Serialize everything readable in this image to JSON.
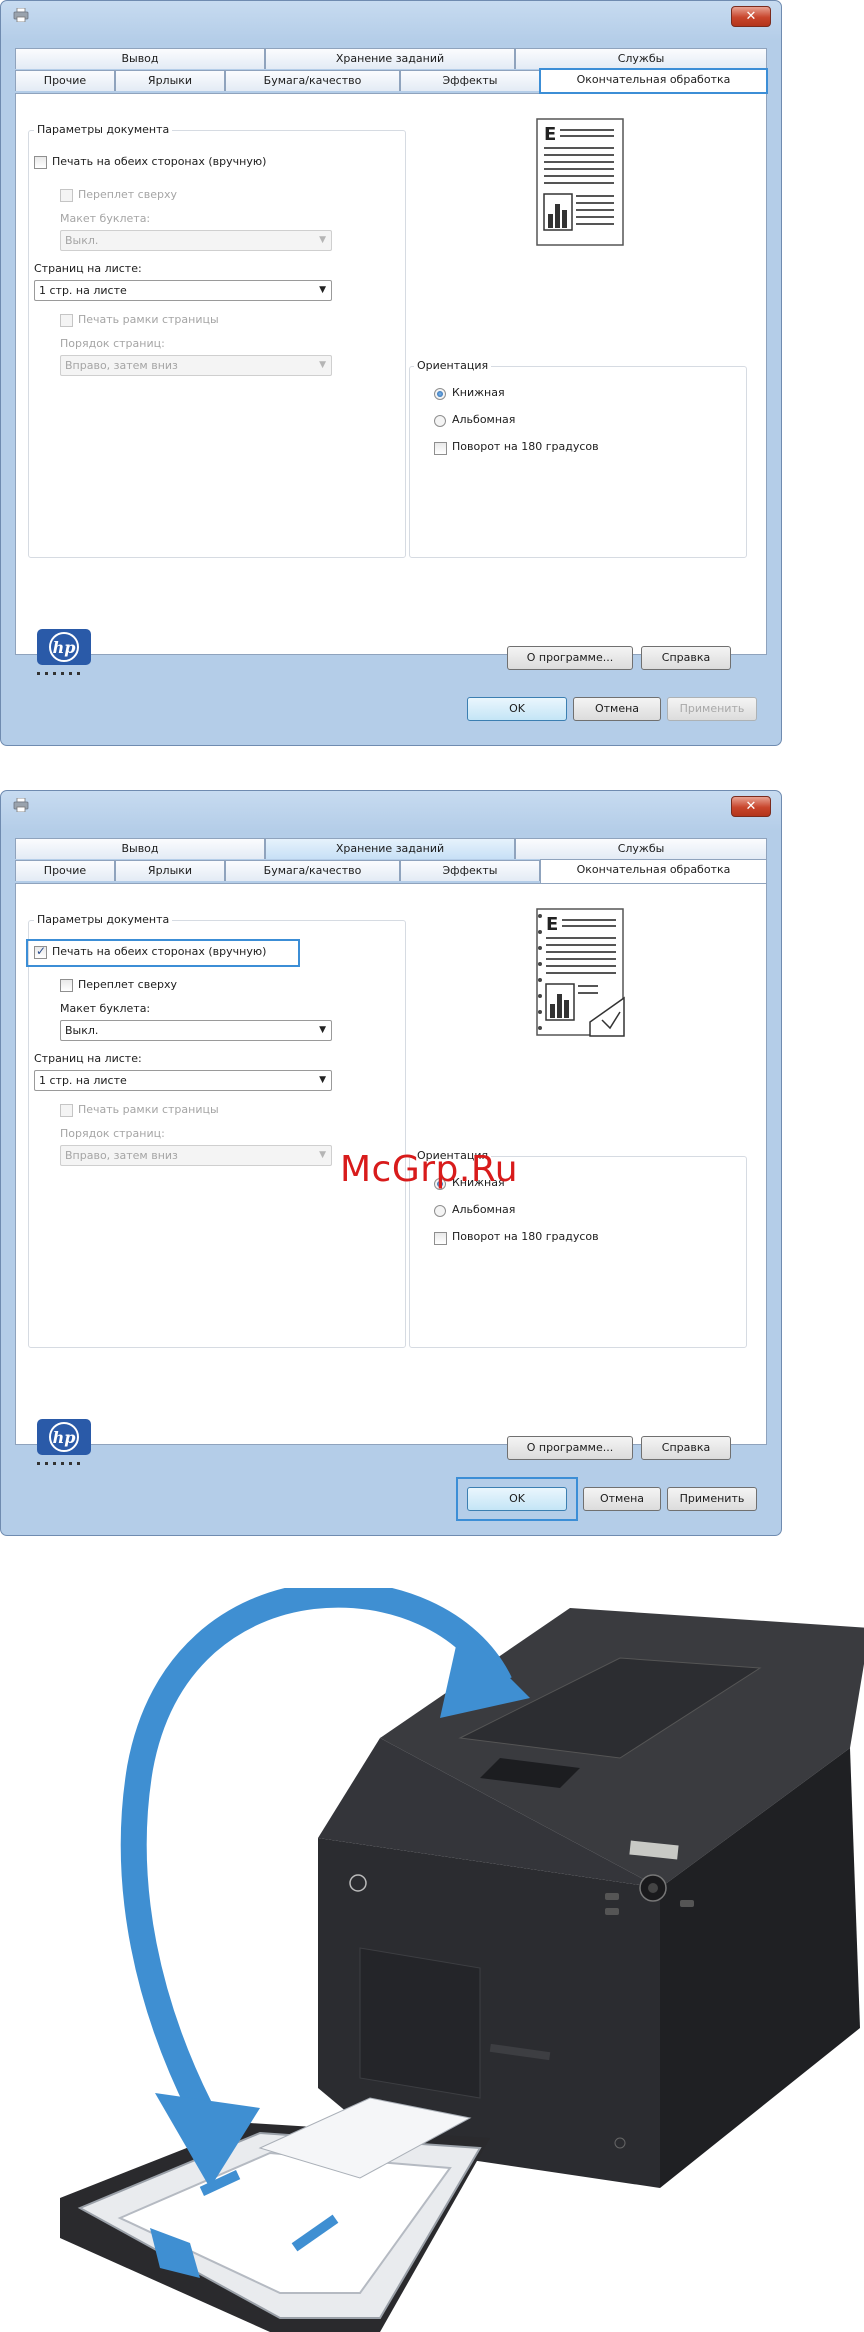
{
  "watermark": "McGrp.Ru",
  "dialog1": {
    "tabs": {
      "top": [
        "Вывод",
        "Хранение заданий",
        "Службы"
      ],
      "bottom": [
        "Прочие",
        "Ярлыки",
        "Бумага/качество",
        "Эффекты",
        "Окончательная обработка"
      ]
    },
    "doc_params": {
      "group_label": "Параметры документа",
      "duplex_label": "Печать на обеих сторонах (вручную)",
      "duplex_checked": false,
      "binding_label": "Переплет сверху",
      "booklet_label": "Макет буклета:",
      "booklet_value": "Выкл.",
      "pages_per_sheet_label": "Страниц на листе:",
      "pages_per_sheet_value": "1 стр. на листе",
      "borders_label": "Печать рамки страницы",
      "page_order_label": "Порядок страниц:",
      "page_order_value": "Вправо, затем вниз"
    },
    "orientation": {
      "group_label": "Ориентация",
      "portrait": "Книжная",
      "landscape": "Альбомная",
      "rotate": "Поворот на 180 градусов"
    },
    "buttons": {
      "about": "О программе...",
      "help": "Справка",
      "ok": "OK",
      "cancel": "Отмена",
      "apply": "Применить"
    }
  },
  "dialog2": {
    "tabs": {
      "top": [
        "Вывод",
        "Хранение заданий",
        "Службы"
      ],
      "bottom": [
        "Прочие",
        "Ярлыки",
        "Бумага/качество",
        "Эффекты",
        "Окончательная обработка"
      ]
    },
    "doc_params": {
      "group_label": "Параметры документа",
      "duplex_label": "Печать на обеих сторонах (вручную)",
      "duplex_checked": true,
      "binding_label": "Переплет сверху",
      "booklet_label": "Макет буклета:",
      "booklet_value": "Выкл.",
      "pages_per_sheet_label": "Страниц на листе:",
      "pages_per_sheet_value": "1 стр. на листе",
      "borders_label": "Печать рамки страницы",
      "page_order_label": "Порядок страниц:",
      "page_order_value": "Вправо, затем вниз"
    },
    "orientation": {
      "group_label": "Ориентация",
      "portrait": "Книжная",
      "landscape": "Альбомная",
      "rotate": "Поворот на 180 градусов"
    },
    "buttons": {
      "about": "О программе...",
      "help": "Справка",
      "ok": "OK",
      "cancel": "Отмена",
      "apply": "Применить"
    }
  },
  "colors": {
    "highlight": "#3c8ed6",
    "arrow": "#3f8fd2",
    "printer": "#2a2b2e"
  }
}
